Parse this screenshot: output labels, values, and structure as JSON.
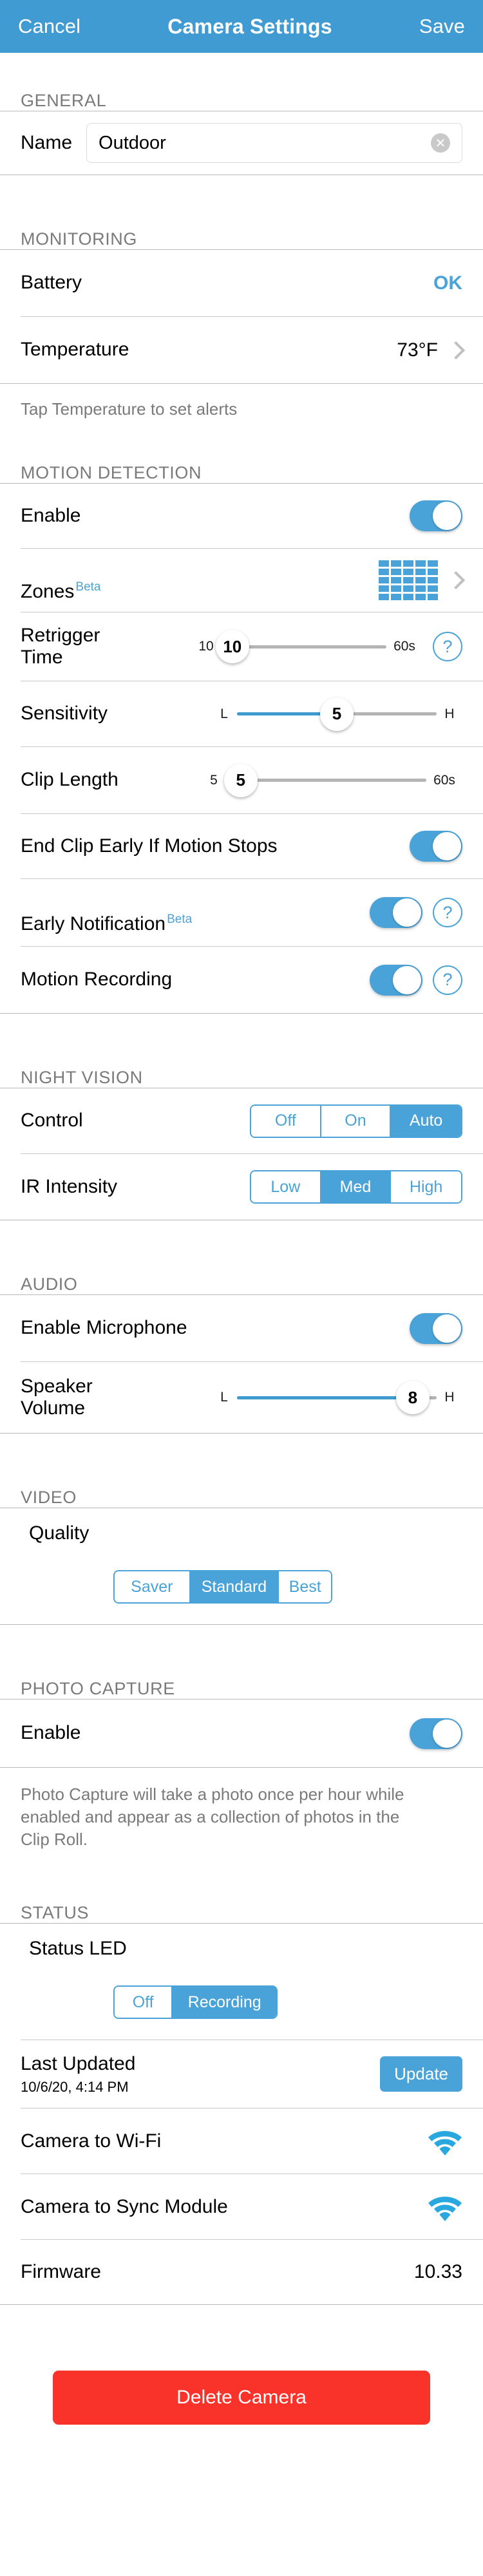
{
  "navbar": {
    "cancel": "Cancel",
    "title": "Camera Settings",
    "save": "Save"
  },
  "sections": {
    "general": {
      "header": "GENERAL",
      "name_label": "Name",
      "name_value": "Outdoor",
      "clear_icon": "clear-circle-icon"
    },
    "monitoring": {
      "header": "MONITORING",
      "battery_label": "Battery",
      "battery_value": "OK",
      "temperature_label": "Temperature",
      "temperature_value": "73°F",
      "footnote": "Tap Temperature to set alerts"
    },
    "motion_detection": {
      "header": "MOTION DETECTION",
      "enable_label": "Enable",
      "enable_on": true,
      "zones_label": "Zones",
      "zones_beta": "Beta",
      "retrigger_label": "Retrigger\nTime",
      "retrigger_min": "10",
      "retrigger_max": "60s",
      "retrigger_value": "10",
      "sensitivity_label": "Sensitivity",
      "sensitivity_min": "L",
      "sensitivity_max": "H",
      "sensitivity_value": "5",
      "clip_length_label": "Clip Length",
      "clip_length_min": "5",
      "clip_length_max": "60s",
      "clip_length_value": "5",
      "end_clip_label": "End Clip Early If Motion Stops",
      "end_clip_on": true,
      "early_notification_label": "Early Notification",
      "early_notification_beta": "Beta",
      "early_notification_on": true,
      "motion_recording_label": "Motion Recording",
      "motion_recording_on": true,
      "help_glyph": "?"
    },
    "night_vision": {
      "header": "NIGHT VISION",
      "control_label": "Control",
      "control_options": [
        "Off",
        "On",
        "Auto"
      ],
      "control_selected": "Auto",
      "ir_label": "IR Intensity",
      "ir_options": [
        "Low",
        "Med",
        "High"
      ],
      "ir_selected": "Med"
    },
    "audio": {
      "header": "AUDIO",
      "mic_label": "Enable Microphone",
      "mic_on": true,
      "speaker_label": "Speaker\nVolume",
      "speaker_min": "L",
      "speaker_max": "H",
      "speaker_value": "8"
    },
    "video": {
      "header": "VIDEO",
      "quality_label": "Quality",
      "quality_options": [
        "Saver",
        "Standard",
        "Best"
      ],
      "quality_selected": "Standard"
    },
    "photo_capture": {
      "header": "PHOTO CAPTURE",
      "enable_label": "Enable",
      "enable_on": true,
      "footnote": "Photo Capture will take a photo once per hour while enabled and appear as a collection of photos in the Clip Roll."
    },
    "status": {
      "header": "STATUS",
      "status_led_label": "Status LED",
      "status_led_options": [
        "Off",
        "Recording"
      ],
      "status_led_selected": "Recording",
      "last_updated_label": "Last Updated",
      "last_updated_value": "10/6/20, 4:14 PM",
      "update_button": "Update",
      "wifi_label": "Camera to Wi-Fi",
      "wifi_icon": "wifi-icon",
      "sync_label": "Camera to Sync Module",
      "sync_icon": "wifi-icon",
      "firmware_label": "Firmware",
      "firmware_value": "10.33"
    }
  },
  "footer": {
    "delete_label": "Delete Camera"
  },
  "colors": {
    "accent": "#4aa3d8",
    "navbar": "#409bd2",
    "danger": "#f9332a",
    "section_text": "#7a7a7a"
  }
}
